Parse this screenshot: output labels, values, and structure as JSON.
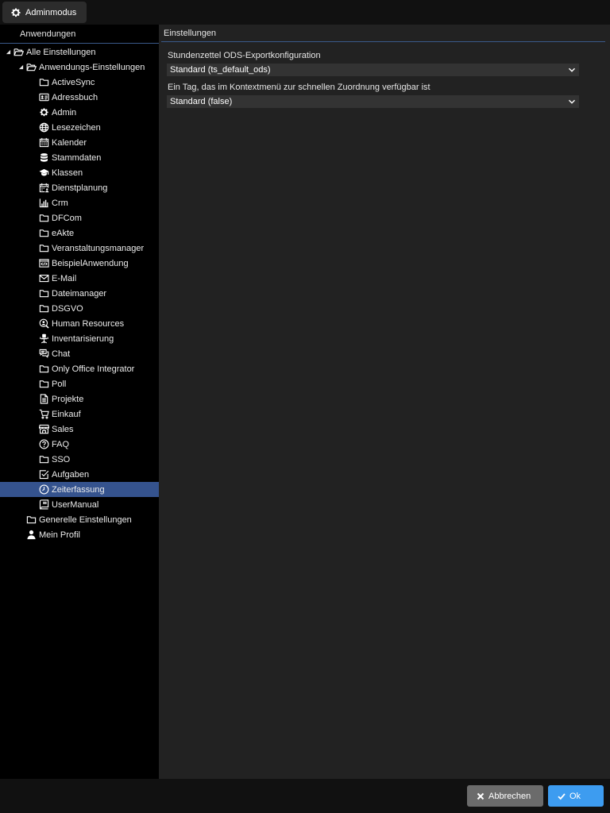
{
  "topbar": {
    "admin_mode_label": "Adminmodus"
  },
  "left_panel": {
    "header": "Anwendungen",
    "tree": [
      {
        "label": "Alle Einstellungen",
        "level": 0,
        "expanded": true,
        "icon": "folder-open-icon"
      },
      {
        "label": "Anwendungs-Einstellungen",
        "level": 1,
        "expanded": true,
        "icon": "folder-open-icon"
      },
      {
        "label": "ActiveSync",
        "level": 2,
        "icon": "folder-icon"
      },
      {
        "label": "Adressbuch",
        "level": 2,
        "icon": "address-card-icon"
      },
      {
        "label": "Admin",
        "level": 2,
        "icon": "gear-icon"
      },
      {
        "label": "Lesezeichen",
        "level": 2,
        "icon": "globe-icon"
      },
      {
        "label": "Kalender",
        "level": 2,
        "icon": "calendar-icon"
      },
      {
        "label": "Stammdaten",
        "level": 2,
        "icon": "database-icon"
      },
      {
        "label": "Klassen",
        "level": 2,
        "icon": "graduation-cap-icon"
      },
      {
        "label": "Dienstplanung",
        "level": 2,
        "icon": "calendar-user-icon"
      },
      {
        "label": "Crm",
        "level": 2,
        "icon": "chart-bar-icon"
      },
      {
        "label": "DFCom",
        "level": 2,
        "icon": "folder-icon"
      },
      {
        "label": "eAkte",
        "level": 2,
        "icon": "folder-icon"
      },
      {
        "label": "Veranstaltungsmanager",
        "level": 2,
        "icon": "folder-icon"
      },
      {
        "label": "BeispielAnwendung",
        "level": 2,
        "icon": "code-window-icon"
      },
      {
        "label": "E-Mail",
        "level": 2,
        "icon": "envelope-icon"
      },
      {
        "label": "Dateimanager",
        "level": 2,
        "icon": "folder-icon"
      },
      {
        "label": "DSGVO",
        "level": 2,
        "icon": "folder-icon"
      },
      {
        "label": "Human Resources",
        "level": 2,
        "icon": "user-search-icon"
      },
      {
        "label": "Inventarisierung",
        "level": 2,
        "icon": "office-chair-icon"
      },
      {
        "label": "Chat",
        "level": 2,
        "icon": "chat-icon"
      },
      {
        "label": "Only Office Integrator",
        "level": 2,
        "icon": "folder-icon"
      },
      {
        "label": "Poll",
        "level": 2,
        "icon": "folder-icon"
      },
      {
        "label": "Projekte",
        "level": 2,
        "icon": "file-text-icon"
      },
      {
        "label": "Einkauf",
        "level": 2,
        "icon": "cart-icon"
      },
      {
        "label": "Sales",
        "level": 2,
        "icon": "store-icon"
      },
      {
        "label": "FAQ",
        "level": 2,
        "icon": "question-circle-icon"
      },
      {
        "label": "SSO",
        "level": 2,
        "icon": "folder-icon"
      },
      {
        "label": "Aufgaben",
        "level": 2,
        "icon": "check-square-icon"
      },
      {
        "label": "Zeiterfassung",
        "level": 2,
        "icon": "clock-icon",
        "selected": true
      },
      {
        "label": "UserManual",
        "level": 2,
        "icon": "book-icon"
      },
      {
        "label": "Generelle Einstellungen",
        "level": 1,
        "icon": "folder-icon"
      },
      {
        "label": "Mein Profil",
        "level": 1,
        "icon": "user-icon"
      }
    ]
  },
  "right_panel": {
    "header": "Einstellungen",
    "fields": [
      {
        "label": "Stundenzettel ODS-Exportkonfiguration",
        "value": "Standard (ts_default_ods)"
      },
      {
        "label": "Ein Tag, das im Kontextmenü zur schnellen Zuordnung verfügbar ist",
        "value": "Standard (false)"
      }
    ]
  },
  "footer": {
    "cancel_label": "Abbrechen",
    "ok_label": "Ok"
  },
  "colors": {
    "selection": "#35538e",
    "ok_button": "#3d9cf0",
    "cancel_button": "#6b6b6b",
    "divider": "#3a5a8a"
  }
}
